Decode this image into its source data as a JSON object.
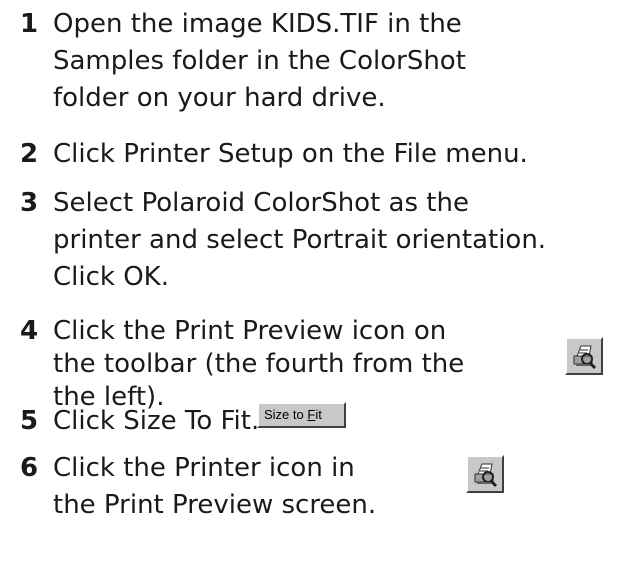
{
  "steps": [
    {
      "number": "1",
      "lines": [
        "Open the image KIDS.TIF in the",
        "Samples folder in the ColorShot",
        "folder on your hard drive."
      ]
    },
    {
      "number": "2",
      "lines": [
        "Click Printer Setup on the File menu."
      ]
    },
    {
      "number": "3",
      "lines": [
        "Select Polaroid ColorShot as the",
        "printer and select Portrait orientation.",
        "Click OK."
      ]
    },
    {
      "number": "4",
      "lines": [
        "Click the Print Preview icon on",
        "the toolbar (the fourth from the",
        "the left)."
      ]
    },
    {
      "number": "5",
      "lines": [
        "Click Size To Fit."
      ]
    },
    {
      "number": "6",
      "lines": [
        "Click the Printer icon in",
        "the Print Preview screen."
      ]
    }
  ],
  "size_to_fit_button": {
    "prefix": "Size to ",
    "mnemonic": "F",
    "suffix": "it"
  },
  "icons": {
    "print_preview": "print-preview-icon",
    "printer": "printer-icon"
  }
}
